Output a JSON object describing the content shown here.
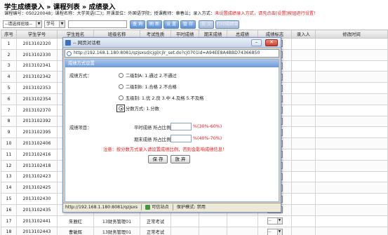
{
  "header": {
    "title": "学生成绩录入 » 课程列表 » 成绩录入",
    "info": "课程编号：050220048；课程名称：大学英语(二)；开课单位：外国语学院；授课教师：章春兰；录入方式：",
    "warning": "未设置成绩录入方式，请先点击[设置]按钮进行设置！"
  },
  "filters": {
    "class_select": "--请选择班级--",
    "field_select": "学号"
  },
  "toolbar": {
    "query": "查 询",
    "refresh": "刷 新",
    "settings": "设 置",
    "save": "暂 存",
    "submit": "提 交",
    "print": "打印成绩单"
  },
  "table": {
    "headers": [
      "序号",
      "学生学号",
      "学生姓名",
      "班级名称",
      "考试性质",
      "平时成绩",
      "期末成绩",
      "总成绩",
      "成绩标志",
      "录入人",
      "修改时间"
    ],
    "rows": [
      {
        "no": "1",
        "id": "2013102320",
        "name": "",
        "cls": "",
        "exam": ""
      },
      {
        "no": "2",
        "id": "2013102330",
        "name": "",
        "cls": "",
        "exam": ""
      },
      {
        "no": "3",
        "id": "2013102341",
        "name": "",
        "cls": "",
        "exam": ""
      },
      {
        "no": "4",
        "id": "2013102342",
        "name": "",
        "cls": "",
        "exam": ""
      },
      {
        "no": "5",
        "id": "2013102353",
        "name": "",
        "cls": "",
        "exam": ""
      },
      {
        "no": "6",
        "id": "2013102354",
        "name": "",
        "cls": "",
        "exam": ""
      },
      {
        "no": "7",
        "id": "2013102370",
        "name": "",
        "cls": "",
        "exam": ""
      },
      {
        "no": "8",
        "id": "2013102392",
        "name": "",
        "cls": "",
        "exam": ""
      },
      {
        "no": "9",
        "id": "2013102395",
        "name": "",
        "cls": "",
        "exam": ""
      },
      {
        "no": "10",
        "id": "2013102406",
        "name": "",
        "cls": "",
        "exam": ""
      },
      {
        "no": "11",
        "id": "2013102416",
        "name": "",
        "cls": "",
        "exam": ""
      },
      {
        "no": "12",
        "id": "2013102418",
        "name": "",
        "cls": "",
        "exam": ""
      },
      {
        "no": "13",
        "id": "2013102423",
        "name": "",
        "cls": "",
        "exam": ""
      },
      {
        "no": "14",
        "id": "2013102425",
        "name": "",
        "cls": "",
        "exam": ""
      },
      {
        "no": "15",
        "id": "2013102430",
        "name": "",
        "cls": "",
        "exam": ""
      },
      {
        "no": "16",
        "id": "2013102435",
        "name": "",
        "cls": "",
        "exam": ""
      },
      {
        "no": "17",
        "id": "2013102441",
        "name": "朱雅红",
        "cls": "13财务管理01",
        "exam": "正常考试"
      },
      {
        "no": "18",
        "id": "2013102443",
        "name": "曹敏辉",
        "cls": "13财务管理01",
        "exam": "正常考试"
      }
    ],
    "flag_dash": "--"
  },
  "popup": {
    "title": "-- 网页对话框",
    "url": "http://192.168.1.180:8081/qzjsxsd/cjgl/cjlr_set.do?cj0701id=A94EE8A4BBD74366850",
    "section": "成绩方式设置",
    "method_label": "成绩方式：",
    "options": [
      "二级制A: 1.通过  2.不通过",
      "二级制B: 1.合格  2.不合格",
      "五级制: 1.优  2.良  3.中  4.及格  5.不及格",
      "分数方式: 1.分数"
    ],
    "item_label": "成绩项目：",
    "usual_label": "平时成绩  所占比例",
    "usual_hint": "%(30%-60%)",
    "final_label": "期末成绩  所占比例",
    "final_hint": "%(40%-70%)",
    "notice": "注意：按分数方式录入请设置成绩比例，否则会影响成绩信息！",
    "save_button": "保 存",
    "cancel_button": "放 弃",
    "status_url": "http://192.168.1.180:8081/qzjsxs",
    "status_site": "可信站点",
    "status_mode": "保护模式: 禁用"
  }
}
